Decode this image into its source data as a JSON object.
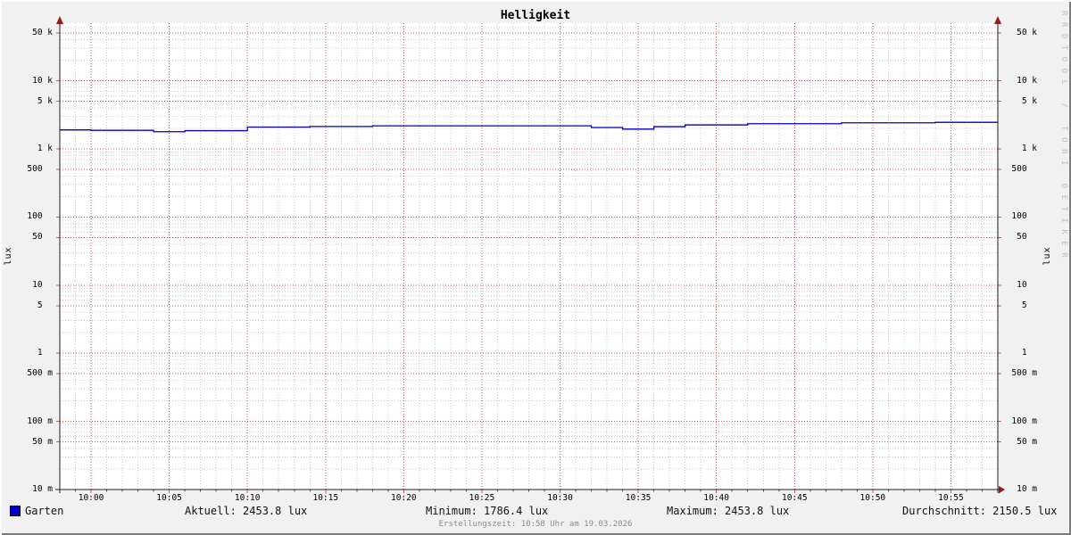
{
  "title": "Helligkeit",
  "signature": "RRDTOOL / TOBI OETIKER",
  "footer": "Erstellungszeit: 10:58 Uhr am 19.03.2026",
  "axis": {
    "left_label": "lux",
    "right_label": "lux"
  },
  "legend": {
    "series_name": "Garten",
    "stats": [
      "Aktuell: 2453.8 lux",
      "Minimum: 1786.4 lux",
      "Maximum: 2453.8 lux",
      "Durchschnitt: 2150.5 lux"
    ]
  },
  "colors": {
    "background": "#f1f1f1",
    "canvas": "#ffffff",
    "major_grid": "#cc5b5b",
    "minor_grid": "#c9c9c9",
    "axis": "#1f1f1f",
    "arrow": "#8b1e1e",
    "series": "#0000c8",
    "minor_tick": "#555555"
  },
  "chart_data": {
    "type": "line",
    "title": "Helligkeit",
    "ylabel": "lux",
    "y_scale": "log",
    "ylim": [
      0.01,
      70000
    ],
    "x_range": [
      "09:58",
      "10:58"
    ],
    "grid": true,
    "legend_position": "bottom-left",
    "y_ticks": [
      {
        "num": "50",
        "unit": "k",
        "value": 50000
      },
      {
        "num": "10",
        "unit": "k",
        "value": 10000
      },
      {
        "num": "5",
        "unit": "k",
        "value": 5000
      },
      {
        "num": "1",
        "unit": "k",
        "value": 1000
      },
      {
        "num": "500",
        "unit": "",
        "value": 500
      },
      {
        "num": "100",
        "unit": "",
        "value": 100
      },
      {
        "num": "50",
        "unit": "",
        "value": 50
      },
      {
        "num": "10",
        "unit": "",
        "value": 10
      },
      {
        "num": "5",
        "unit": "",
        "value": 5
      },
      {
        "num": "1",
        "unit": "",
        "value": 1
      },
      {
        "num": "500",
        "unit": "m",
        "value": 0.5
      },
      {
        "num": "100",
        "unit": "m",
        "value": 0.1
      },
      {
        "num": "50",
        "unit": "m",
        "value": 0.05
      },
      {
        "num": "10",
        "unit": "m",
        "value": 0.01
      }
    ],
    "x_ticks": [
      "10:00",
      "10:05",
      "10:10",
      "10:15",
      "10:20",
      "10:25",
      "10:30",
      "10:35",
      "10:40",
      "10:45",
      "10:50",
      "10:55"
    ],
    "series": [
      {
        "name": "Garten",
        "color": "#0000c8",
        "unit": "lux",
        "stats": {
          "current": 2453.8,
          "min": 1786.4,
          "max": 2453.8,
          "avg": 2150.5
        },
        "end_time": "10:58",
        "steps": [
          {
            "time": "09:58",
            "value": 1900
          },
          {
            "time": "10:00",
            "value": 1870
          },
          {
            "time": "10:04",
            "value": 1786.4
          },
          {
            "time": "10:06",
            "value": 1850
          },
          {
            "time": "10:10",
            "value": 2090
          },
          {
            "time": "10:14",
            "value": 2130
          },
          {
            "time": "10:18",
            "value": 2180
          },
          {
            "time": "10:32",
            "value": 2060
          },
          {
            "time": "10:34",
            "value": 1950
          },
          {
            "time": "10:36",
            "value": 2120
          },
          {
            "time": "10:38",
            "value": 2250
          },
          {
            "time": "10:42",
            "value": 2340
          },
          {
            "time": "10:48",
            "value": 2410
          },
          {
            "time": "10:54",
            "value": 2453.8
          }
        ]
      }
    ]
  }
}
